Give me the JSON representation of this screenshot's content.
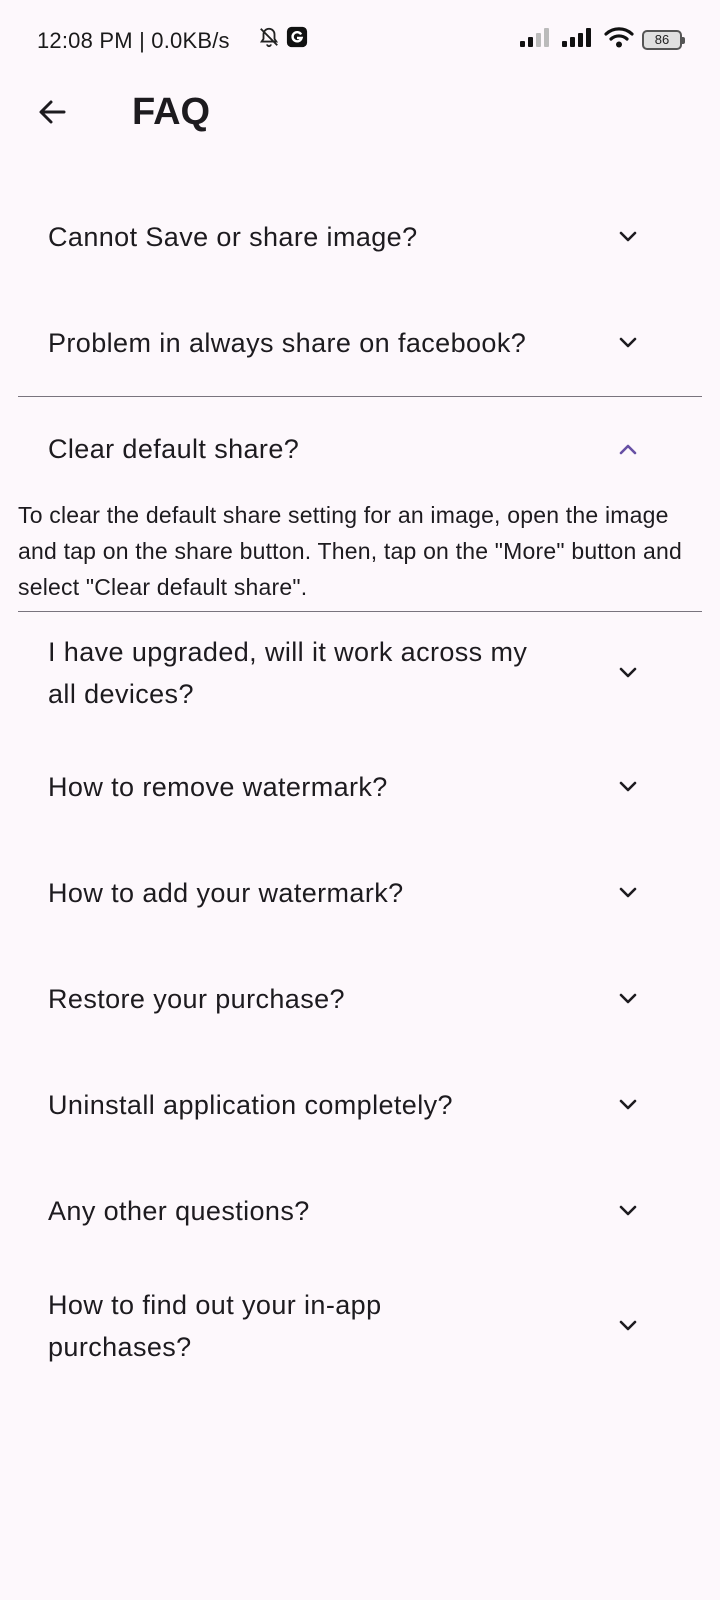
{
  "status_bar": {
    "time_text": "12:08 PM | 0.0KB/s",
    "battery_level": "86",
    "notification_icon": "g-icon"
  },
  "app_bar": {
    "title": "FAQ"
  },
  "faq": [
    {
      "question": "Cannot Save or share image?",
      "expanded": false
    },
    {
      "question": "Problem in always share on facebook?",
      "expanded": false
    },
    {
      "question": "Clear default share?",
      "expanded": true,
      "answer": "To clear the default share setting for an image, open the image and tap on the share button. Then, tap on the \"More\" button and select \"Clear default share\"."
    },
    {
      "question": "I have upgraded, will it work across my all devices?",
      "expanded": false
    },
    {
      "question": "How to remove watermark?",
      "expanded": false
    },
    {
      "question": "How to add your watermark?",
      "expanded": false
    },
    {
      "question": "Restore your purchase?",
      "expanded": false
    },
    {
      "question": "Uninstall application completely?",
      "expanded": false
    },
    {
      "question": "Any other questions?",
      "expanded": false
    },
    {
      "question": "How to find out your in-app purchases?",
      "expanded": false
    }
  ],
  "colors": {
    "background": "#fdf8fc",
    "accent": "#6750a4",
    "text": "#1d1b1f"
  }
}
